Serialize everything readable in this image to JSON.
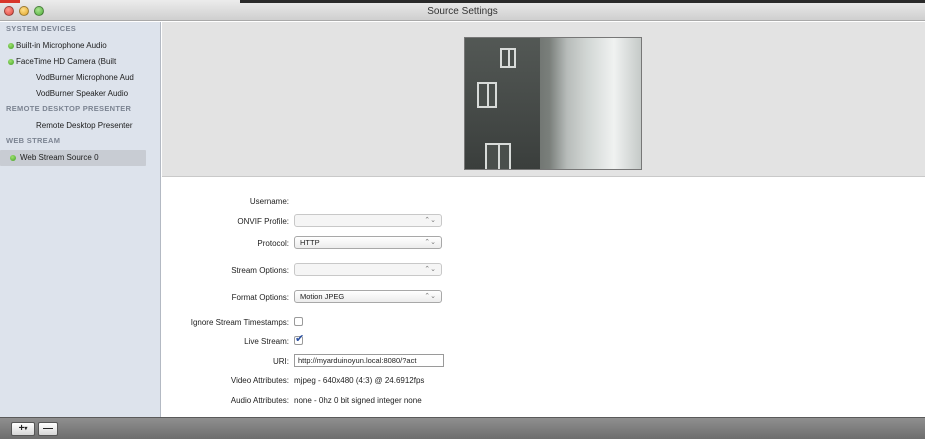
{
  "window": {
    "title": "Source Settings"
  },
  "sidebar": {
    "groups": [
      {
        "header": "SYSTEM DEVICES",
        "items": [
          {
            "label": "Built-in Microphone Audio",
            "status": true
          },
          {
            "label": "FaceTime HD Camera (Built",
            "status": true
          },
          {
            "label": "VodBurner Microphone Aud",
            "status": false
          },
          {
            "label": "VodBurner Speaker Audio",
            "status": false
          }
        ]
      },
      {
        "header": "REMOTE DESKTOP PRESENTER",
        "items": [
          {
            "label": "Remote Desktop Presenter",
            "status": false
          }
        ]
      },
      {
        "header": "WEB STREAM",
        "items": [
          {
            "label": "Web Stream Source 0",
            "status": true,
            "selected": true
          }
        ]
      }
    ]
  },
  "form": {
    "username": {
      "label": "Username:",
      "value": ""
    },
    "onvif_profile": {
      "label": "ONVIF Profile:",
      "value": ""
    },
    "protocol": {
      "label": "Protocol:",
      "value": "HTTP"
    },
    "stream_options": {
      "label": "Stream Options:",
      "value": ""
    },
    "format_options": {
      "label": "Format Options:",
      "value": "Motion JPEG"
    },
    "ignore_timestamps": {
      "label": "Ignore Stream Timestamps:",
      "checked": false
    },
    "live_stream": {
      "label": "Live Stream:",
      "checked": true
    },
    "uri": {
      "label": "URI:",
      "value": "http://myarduinoyun.local:8080/?act"
    },
    "video_attributes": {
      "label": "Video Attributes:",
      "value": "mjpeg - 640x480 (4:3) @ 24.6912fps"
    },
    "audio_attributes": {
      "label": "Audio Attributes:",
      "value": "none - 0hz 0 bit signed integer none"
    }
  },
  "bottombar": {
    "add_label": "+",
    "remove_label": "—"
  },
  "icons": {
    "select_arrows": "⌃⌄",
    "dropdown_caret": "▾"
  },
  "colors": {
    "status_green": "#3f9f22",
    "sidebar_bg": "#dde3ec",
    "selected_bg": "#c8ccd3"
  }
}
